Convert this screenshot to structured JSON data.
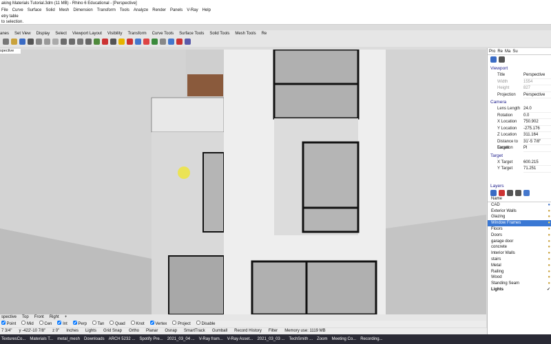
{
  "title": "aking Materials Tutorial.3dm (11 MB) - Rhino 6 Educational - [Perspective]",
  "menu": [
    "File",
    "Curve",
    "Surface",
    "Solid",
    "Mesh",
    "Dimension",
    "Transform",
    "Tools",
    "Analyze",
    "Render",
    "Panels",
    "V-Ray",
    "Help"
  ],
  "command": {
    "line1": "etry table",
    "line2": "to selection."
  },
  "toolbar_tabs": [
    "anes",
    "Set View",
    "Display",
    "Select",
    "Viewport Layout",
    "Visibility",
    "Transform",
    "Curve Tools",
    "Surface Tools",
    "Solid Tools",
    "Mesh Tools",
    "Re"
  ],
  "viewport_label": "spective",
  "viewport_tabs": [
    "spective",
    "Top",
    "Front",
    "Right",
    "+"
  ],
  "osnaps": [
    {
      "label": "Point",
      "checked": true
    },
    {
      "label": "Mid",
      "checked": false
    },
    {
      "label": "Cen",
      "checked": false
    },
    {
      "label": "Int",
      "checked": true
    },
    {
      "label": "Perp",
      "checked": true
    },
    {
      "label": "Tan",
      "checked": false
    },
    {
      "label": "Quad",
      "checked": false
    },
    {
      "label": "Knot",
      "checked": false
    },
    {
      "label": "Vertex",
      "checked": true
    },
    {
      "label": "Project",
      "checked": false
    },
    {
      "label": "Disable",
      "checked": false
    }
  ],
  "status": {
    "coord1": "7 3/4\"",
    "coord2": "y -422'-10 7/8\"",
    "coord3": "z 0\"",
    "units": "Inches",
    "layer": "Lights",
    "items": [
      "Grid Snap",
      "Ortho",
      "Planar",
      "Osnap",
      "SmartTrack",
      "Gumball",
      "Record History",
      "Filter",
      "Memory use: 1119 MB"
    ]
  },
  "panel_tabs": [
    "Pro",
    "Re",
    "Ma",
    "Su"
  ],
  "properties": {
    "viewport_header": "Viewport",
    "title_label": "Title",
    "title_value": "Perspective",
    "width_label": "Width",
    "width_value": "1554",
    "height_label": "Height",
    "height_value": "827",
    "projection_label": "Projection",
    "projection_value": "Perspective",
    "camera_header": "Camera",
    "lens_label": "Lens Length",
    "lens_value": "24.0",
    "rotation_label": "Rotation",
    "rotation_value": "0.0",
    "xloc_label": "X Location",
    "xloc_value": "750.902",
    "yloc_label": "Y Location",
    "yloc_value": "-275.176",
    "zloc_label": "Z Location",
    "zloc_value": "311.164",
    "dist_label": "Distance to Target",
    "dist_value": "31'-5 7/8\"",
    "location_label": "Location",
    "location_value": "Pl",
    "target_header": "Target",
    "xt_label": "X Target",
    "xt_value": "600.215",
    "yt_label": "Y Target",
    "yt_value": "71.251"
  },
  "layers": {
    "header": "Layers",
    "name_col": "Name",
    "items": [
      "CAD",
      "Exterior Walls",
      "Glazing",
      "Window Frames",
      "Floors",
      "Doors",
      "garage door",
      "concrete",
      "Interior Walls",
      "stairs",
      "Metal",
      "Railing",
      "Wood",
      "Standing Seam",
      "Lights"
    ],
    "selected": "Window Frames",
    "current": "Lights"
  },
  "taskbar": [
    "TexturesCo...",
    "Materials T...",
    "metal_mesh",
    "Downloads",
    "ARCH 5232 ...",
    "Spotify Pre...",
    "2021_03_04 ...",
    "V-Ray fram...",
    "V-Ray Asset...",
    "2021_03_03 ...",
    "TechSmith ...",
    "Zoom",
    "Meeting Co...",
    "Recording..."
  ]
}
